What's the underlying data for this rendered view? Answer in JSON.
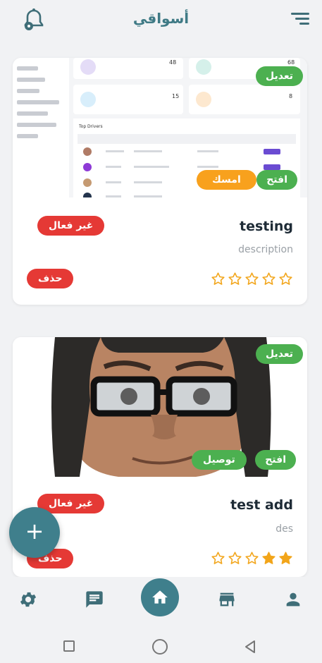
{
  "app": {
    "title": "أسواقي",
    "colors": {
      "primary": "#3f7f8c",
      "green": "#4cb050",
      "orange": "#f8a11d",
      "red": "#e53935",
      "star": "#f2a51a"
    }
  },
  "header": {
    "bell_icon": "bell-icon",
    "menu_icon": "menu-icon"
  },
  "stores": [
    {
      "name": "testing",
      "description": "description",
      "edit_label": "تعديل",
      "open_label": "افتح",
      "hold_label": "امسك",
      "status_label": "غير فعال",
      "delete_label": "حذف",
      "rating": 0,
      "max_rating": 5,
      "dashboard_preview": {
        "stats": [
          "48",
          "68",
          "15",
          "8"
        ],
        "table_title": "Top Drivers"
      }
    },
    {
      "name": "test add",
      "description": "des",
      "edit_label": "تعديل",
      "open_label": "افتح",
      "delivery_label": "توصيل",
      "status_label": "غير فعال",
      "delete_label": "حذف",
      "rating": 2,
      "max_rating": 5
    }
  ],
  "fab": {
    "label": "+"
  },
  "bottom_nav": [
    "settings-icon",
    "chat-icon",
    "home-icon",
    "store-icon",
    "person-icon"
  ]
}
